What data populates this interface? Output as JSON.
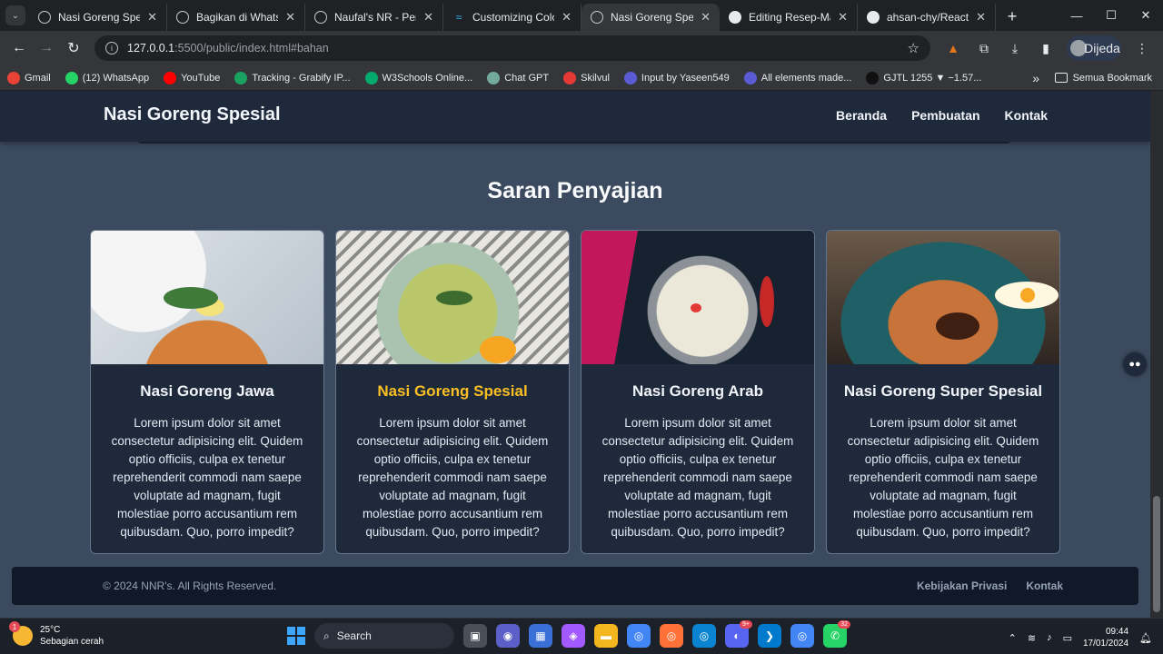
{
  "browser": {
    "tabs": [
      {
        "title": "Nasi Goreng Spesial",
        "icon": "globe-icon",
        "active": false
      },
      {
        "title": "Bagikan di WhatsApp",
        "icon": "globe-icon",
        "active": false
      },
      {
        "title": "Naufal's NR - Person",
        "icon": "globe-icon",
        "active": false
      },
      {
        "title": "Customizing Colors",
        "icon": "tailwind-icon",
        "active": false
      },
      {
        "title": "Nasi Goreng Spesial",
        "icon": "globe-icon",
        "active": true
      },
      {
        "title": "Editing Resep-Makar",
        "icon": "github-icon",
        "active": false
      },
      {
        "title": "ahsan-chy/React-JS-",
        "icon": "github-icon",
        "active": false
      }
    ],
    "url_host": "127.0.0.1",
    "url_rest": ":5500/public/index.html#bahan",
    "profile_label": "Dijeda",
    "bookmarks": [
      {
        "label": "Gmail",
        "color": "#ea4335"
      },
      {
        "label": "(12) WhatsApp",
        "color": "#25d366"
      },
      {
        "label": "YouTube",
        "color": "#ff0000"
      },
      {
        "label": "Tracking - Grabify IP...",
        "color": "#1aa260"
      },
      {
        "label": "W3Schools Online...",
        "color": "#04aa6d"
      },
      {
        "label": "Chat GPT",
        "color": "#74aa9c"
      },
      {
        "label": "Skilvul",
        "color": "#e53935"
      },
      {
        "label": "Input by Yaseen549",
        "color": "#5b5bd6"
      },
      {
        "label": "All elements made...",
        "color": "#5b5bd6"
      },
      {
        "label": "GJTL 1255 ▼ −1.57...",
        "color": "#111111"
      }
    ],
    "bookmarks_folder": "Semua Bookmark"
  },
  "site": {
    "brand": "Nasi Goreng Spesial",
    "nav": [
      "Beranda",
      "Pembuatan",
      "Kontak"
    ],
    "section_title": "Saran Penyajian",
    "cards": [
      {
        "title": "Nasi Goreng Jawa",
        "highlight": false,
        "text": "Lorem ipsum dolor sit amet consectetur adipisicing elit. Quidem optio officiis, culpa ex tenetur reprehenderit commodi nam saepe voluptate ad magnam, fugit molestiae porro accusantium rem quibusdam. Quo, porro impedit?"
      },
      {
        "title": "Nasi Goreng Spesial",
        "highlight": true,
        "text": "Lorem ipsum dolor sit amet consectetur adipisicing elit. Quidem optio officiis, culpa ex tenetur reprehenderit commodi nam saepe voluptate ad magnam, fugit molestiae porro accusantium rem quibusdam. Quo, porro impedit?"
      },
      {
        "title": "Nasi Goreng Arab",
        "highlight": false,
        "text": "Lorem ipsum dolor sit amet consectetur adipisicing elit. Quidem optio officiis, culpa ex tenetur reprehenderit commodi nam saepe voluptate ad magnam, fugit molestiae porro accusantium rem quibusdam. Quo, porro impedit?"
      },
      {
        "title": "Nasi Goreng Super Spesial",
        "highlight": false,
        "text": "Lorem ipsum dolor sit amet consectetur adipisicing elit. Quidem optio officiis, culpa ex tenetur reprehenderit commodi nam saepe voluptate ad magnam, fugit molestiae porro accusantium rem quibusdam. Quo, porro impedit?"
      }
    ],
    "accent_color": "#fbbf24",
    "footer": {
      "copyright": "© 2024 NNR's. All Rights Reserved.",
      "links": [
        "Kebijakan Privasi",
        "Kontak"
      ]
    }
  },
  "taskbar": {
    "weather_temp": "25°C",
    "weather_desc": "Sebagian cerah",
    "weather_badge": "1",
    "search_placeholder": "Search",
    "badges": {
      "discord": "9+",
      "whatsapp": "32"
    },
    "time": "09:44",
    "date": "17/01/2024"
  }
}
